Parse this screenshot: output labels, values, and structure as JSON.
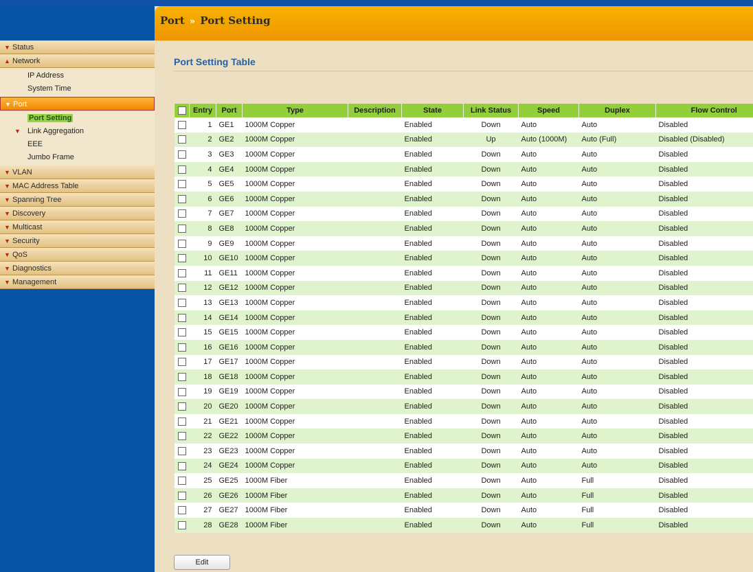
{
  "header": {
    "section": "Port",
    "page": "Port Setting",
    "separator": "»"
  },
  "page_title": "Port Setting Table",
  "nav": {
    "status": "Status",
    "network": "Network",
    "network_sub": [
      "IP Address",
      "System Time"
    ],
    "port": "Port",
    "port_sub": {
      "port_setting": "Port Setting",
      "link_aggregation": "Link Aggregation",
      "eee": "EEE",
      "jumbo_frame": "Jumbo Frame"
    },
    "vlan": "VLAN",
    "mac": "MAC Address Table",
    "stp": "Spanning Tree",
    "discovery": "Discovery",
    "multicast": "Multicast",
    "security": "Security",
    "qos": "QoS",
    "diagnostics": "Diagnostics",
    "management": "Management"
  },
  "table": {
    "columns": [
      "Entry",
      "Port",
      "Type",
      "Description",
      "State",
      "Link Status",
      "Speed",
      "Duplex",
      "Flow Control"
    ],
    "rows": [
      [
        "1",
        "GE1",
        "1000M Copper",
        "",
        "Enabled",
        "Down",
        "Auto",
        "Auto",
        "Disabled"
      ],
      [
        "2",
        "GE2",
        "1000M Copper",
        "",
        "Enabled",
        "Up",
        "Auto (1000M)",
        "Auto (Full)",
        "Disabled (Disabled)"
      ],
      [
        "3",
        "GE3",
        "1000M Copper",
        "",
        "Enabled",
        "Down",
        "Auto",
        "Auto",
        "Disabled"
      ],
      [
        "4",
        "GE4",
        "1000M Copper",
        "",
        "Enabled",
        "Down",
        "Auto",
        "Auto",
        "Disabled"
      ],
      [
        "5",
        "GE5",
        "1000M Copper",
        "",
        "Enabled",
        "Down",
        "Auto",
        "Auto",
        "Disabled"
      ],
      [
        "6",
        "GE6",
        "1000M Copper",
        "",
        "Enabled",
        "Down",
        "Auto",
        "Auto",
        "Disabled"
      ],
      [
        "7",
        "GE7",
        "1000M Copper",
        "",
        "Enabled",
        "Down",
        "Auto",
        "Auto",
        "Disabled"
      ],
      [
        "8",
        "GE8",
        "1000M Copper",
        "",
        "Enabled",
        "Down",
        "Auto",
        "Auto",
        "Disabled"
      ],
      [
        "9",
        "GE9",
        "1000M Copper",
        "",
        "Enabled",
        "Down",
        "Auto",
        "Auto",
        "Disabled"
      ],
      [
        "10",
        "GE10",
        "1000M Copper",
        "",
        "Enabled",
        "Down",
        "Auto",
        "Auto",
        "Disabled"
      ],
      [
        "11",
        "GE11",
        "1000M Copper",
        "",
        "Enabled",
        "Down",
        "Auto",
        "Auto",
        "Disabled"
      ],
      [
        "12",
        "GE12",
        "1000M Copper",
        "",
        "Enabled",
        "Down",
        "Auto",
        "Auto",
        "Disabled"
      ],
      [
        "13",
        "GE13",
        "1000M Copper",
        "",
        "Enabled",
        "Down",
        "Auto",
        "Auto",
        "Disabled"
      ],
      [
        "14",
        "GE14",
        "1000M Copper",
        "",
        "Enabled",
        "Down",
        "Auto",
        "Auto",
        "Disabled"
      ],
      [
        "15",
        "GE15",
        "1000M Copper",
        "",
        "Enabled",
        "Down",
        "Auto",
        "Auto",
        "Disabled"
      ],
      [
        "16",
        "GE16",
        "1000M Copper",
        "",
        "Enabled",
        "Down",
        "Auto",
        "Auto",
        "Disabled"
      ],
      [
        "17",
        "GE17",
        "1000M Copper",
        "",
        "Enabled",
        "Down",
        "Auto",
        "Auto",
        "Disabled"
      ],
      [
        "18",
        "GE18",
        "1000M Copper",
        "",
        "Enabled",
        "Down",
        "Auto",
        "Auto",
        "Disabled"
      ],
      [
        "19",
        "GE19",
        "1000M Copper",
        "",
        "Enabled",
        "Down",
        "Auto",
        "Auto",
        "Disabled"
      ],
      [
        "20",
        "GE20",
        "1000M Copper",
        "",
        "Enabled",
        "Down",
        "Auto",
        "Auto",
        "Disabled"
      ],
      [
        "21",
        "GE21",
        "1000M Copper",
        "",
        "Enabled",
        "Down",
        "Auto",
        "Auto",
        "Disabled"
      ],
      [
        "22",
        "GE22",
        "1000M Copper",
        "",
        "Enabled",
        "Down",
        "Auto",
        "Auto",
        "Disabled"
      ],
      [
        "23",
        "GE23",
        "1000M Copper",
        "",
        "Enabled",
        "Down",
        "Auto",
        "Auto",
        "Disabled"
      ],
      [
        "24",
        "GE24",
        "1000M Copper",
        "",
        "Enabled",
        "Down",
        "Auto",
        "Auto",
        "Disabled"
      ],
      [
        "25",
        "GE25",
        "1000M Fiber",
        "",
        "Enabled",
        "Down",
        "Auto",
        "Full",
        "Disabled"
      ],
      [
        "26",
        "GE26",
        "1000M Fiber",
        "",
        "Enabled",
        "Down",
        "Auto",
        "Full",
        "Disabled"
      ],
      [
        "27",
        "GE27",
        "1000M Fiber",
        "",
        "Enabled",
        "Down",
        "Auto",
        "Full",
        "Disabled"
      ],
      [
        "28",
        "GE28",
        "1000M Fiber",
        "",
        "Enabled",
        "Down",
        "Auto",
        "Full",
        "Disabled"
      ]
    ]
  },
  "edit_label": "Edit"
}
